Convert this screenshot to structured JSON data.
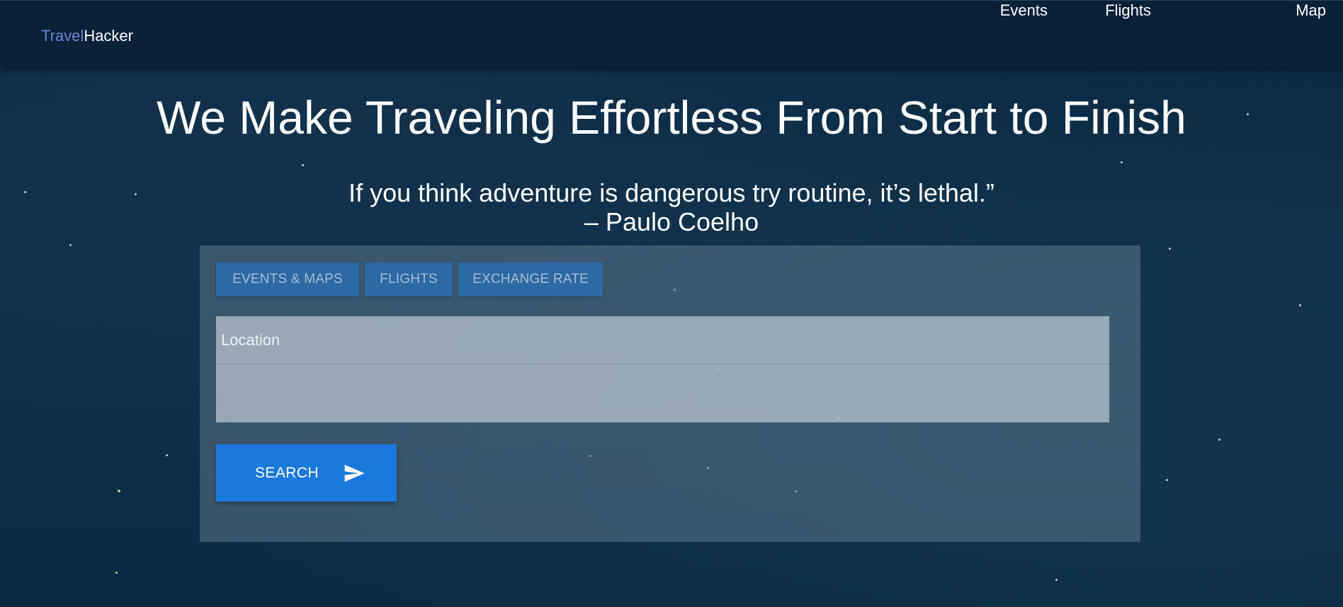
{
  "brand": {
    "part1": "Travel",
    "part2": "Hacker"
  },
  "nav": {
    "events": "Events",
    "flights": "Flights",
    "map": "Map"
  },
  "hero": {
    "title": "We Make Traveling Effortless From Start to Finish",
    "quote": "If you think adventure is dangerous try routine, it’s lethal.”",
    "author": "– Paulo Coelho"
  },
  "tabs": {
    "events_maps": "EVENTS & MAPS",
    "flights": "FLIGHTS",
    "exchange_rate": "EXCHANGE RATE"
  },
  "search": {
    "location_placeholder": "Location",
    "button_label": "SEARCH",
    "button_icon": "send-icon"
  },
  "colors": {
    "brand_accent": "#6b85d8",
    "primary_button": "#1c78dc",
    "tab_background": "#2c6aa6"
  }
}
